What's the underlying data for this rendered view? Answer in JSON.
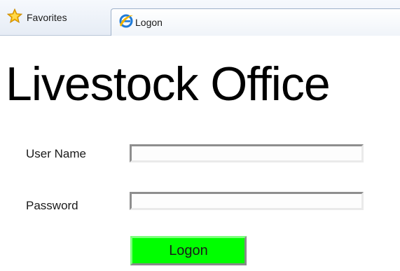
{
  "browser": {
    "favorites_label": "Favorites",
    "favorites_icon": "star-icon",
    "tab": {
      "label": "Logon",
      "icon": "internet-explorer-icon"
    }
  },
  "page": {
    "title": "Livestock Office",
    "username_label": "User Name",
    "username_value": "",
    "password_label": "Password",
    "password_value": "",
    "logon_label": "Logon"
  },
  "colors": {
    "logon_button": "#00ff00",
    "toolbar_bg": "#eef3fa",
    "star": "#f7b500",
    "ie_blue": "#1e7ad8"
  }
}
